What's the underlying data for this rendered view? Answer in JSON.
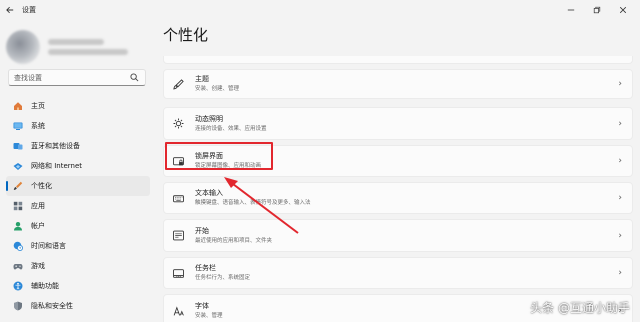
{
  "window": {
    "title": "设置",
    "back_icon": "back-arrow-icon",
    "controls": [
      "minimize-icon",
      "maximize-icon",
      "close-icon"
    ]
  },
  "search": {
    "placeholder": "查找设置"
  },
  "sidebar": {
    "items": [
      {
        "label": "主页",
        "icon": "home-icon",
        "active": false
      },
      {
        "label": "系统",
        "icon": "monitor-icon",
        "active": false
      },
      {
        "label": "蓝牙和其他设备",
        "icon": "bluetooth-icon",
        "active": false
      },
      {
        "label": "网络和 Internet",
        "icon": "network-icon",
        "active": false
      },
      {
        "label": "个性化",
        "icon": "brush-icon",
        "active": true
      },
      {
        "label": "应用",
        "icon": "apps-icon",
        "active": false
      },
      {
        "label": "帐户",
        "icon": "user-icon",
        "active": false
      },
      {
        "label": "时间和语言",
        "icon": "globe-clock-icon",
        "active": false
      },
      {
        "label": "游戏",
        "icon": "gamepad-icon",
        "active": false
      },
      {
        "label": "辅助功能",
        "icon": "accessibility-icon",
        "active": false
      },
      {
        "label": "隐私和安全性",
        "icon": "shield-icon",
        "active": false
      }
    ]
  },
  "main": {
    "title": "个性化",
    "cards": [
      {
        "title": "主题",
        "desc": "安装、创建、管理",
        "icon": "brush-icon"
      },
      {
        "title": "动态照明",
        "desc": "连接的设备、效果、应用设置",
        "icon": "sun-icon"
      },
      {
        "title": "锁屏界面",
        "desc": "锁定屏幕图像、应用和动画",
        "icon": "lock-screen-icon"
      },
      {
        "title": "文本输入",
        "desc": "触摸键盘、语音输入、表情符号及更多、输入法",
        "icon": "keyboard-icon"
      },
      {
        "title": "开始",
        "desc": "最近使用的应用和项目、文件夹",
        "icon": "start-icon"
      },
      {
        "title": "任务栏",
        "desc": "任务栏行为、系统固定",
        "icon": "taskbar-icon"
      },
      {
        "title": "字体",
        "desc": "安装、管理",
        "icon": "font-icon"
      }
    ]
  },
  "annotation": {
    "color": "#e2272e",
    "target": "锁屏界面"
  },
  "accent_color": "#0067c0",
  "watermark": "头条 @互通小助手"
}
